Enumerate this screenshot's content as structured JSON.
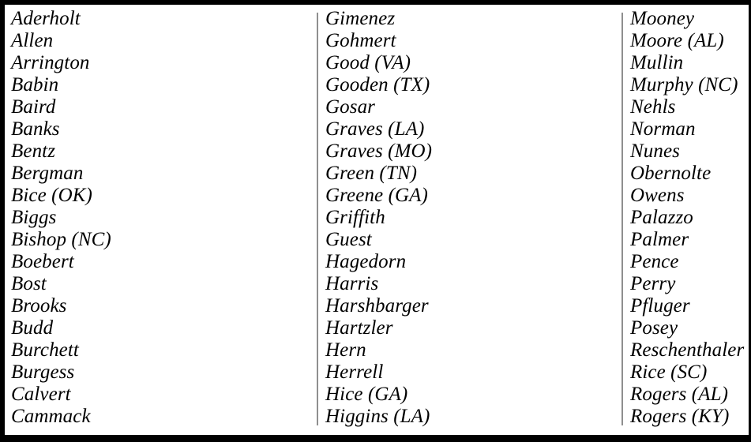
{
  "document": {
    "type": "roll-call-name-list",
    "border_color": "#000000",
    "divider_color": "#8f8f8f",
    "text_color": "#000000",
    "columns": [
      {
        "id": "column-1",
        "names": [
          "Aderholt",
          "Allen",
          "Arrington",
          "Babin",
          "Baird",
          "Banks",
          "Bentz",
          "Bergman",
          "Bice (OK)",
          "Biggs",
          "Bishop (NC)",
          "Boebert",
          "Bost",
          "Brooks",
          "Budd",
          "Burchett",
          "Burgess",
          "Calvert",
          "Cammack"
        ]
      },
      {
        "id": "column-2",
        "names": [
          "Gimenez",
          "Gohmert",
          "Good (VA)",
          "Gooden (TX)",
          "Gosar",
          "Graves (LA)",
          "Graves (MO)",
          "Green (TN)",
          "Greene (GA)",
          "Griffith",
          "Guest",
          "Hagedorn",
          "Harris",
          "Harshbarger",
          "Hartzler",
          "Hern",
          "Herrell",
          "Hice (GA)",
          "Higgins (LA)"
        ]
      },
      {
        "id": "column-3",
        "names": [
          "Mooney",
          "Moore (AL)",
          "Mullin",
          "Murphy (NC)",
          "Nehls",
          "Norman",
          "Nunes",
          "Obernolte",
          "Owens",
          "Palazzo",
          "Palmer",
          "Pence",
          "Perry",
          "Pfluger",
          "Posey",
          "Reschenthaler",
          "Rice (SC)",
          "Rogers (AL)",
          "Rogers (KY)"
        ]
      }
    ]
  }
}
